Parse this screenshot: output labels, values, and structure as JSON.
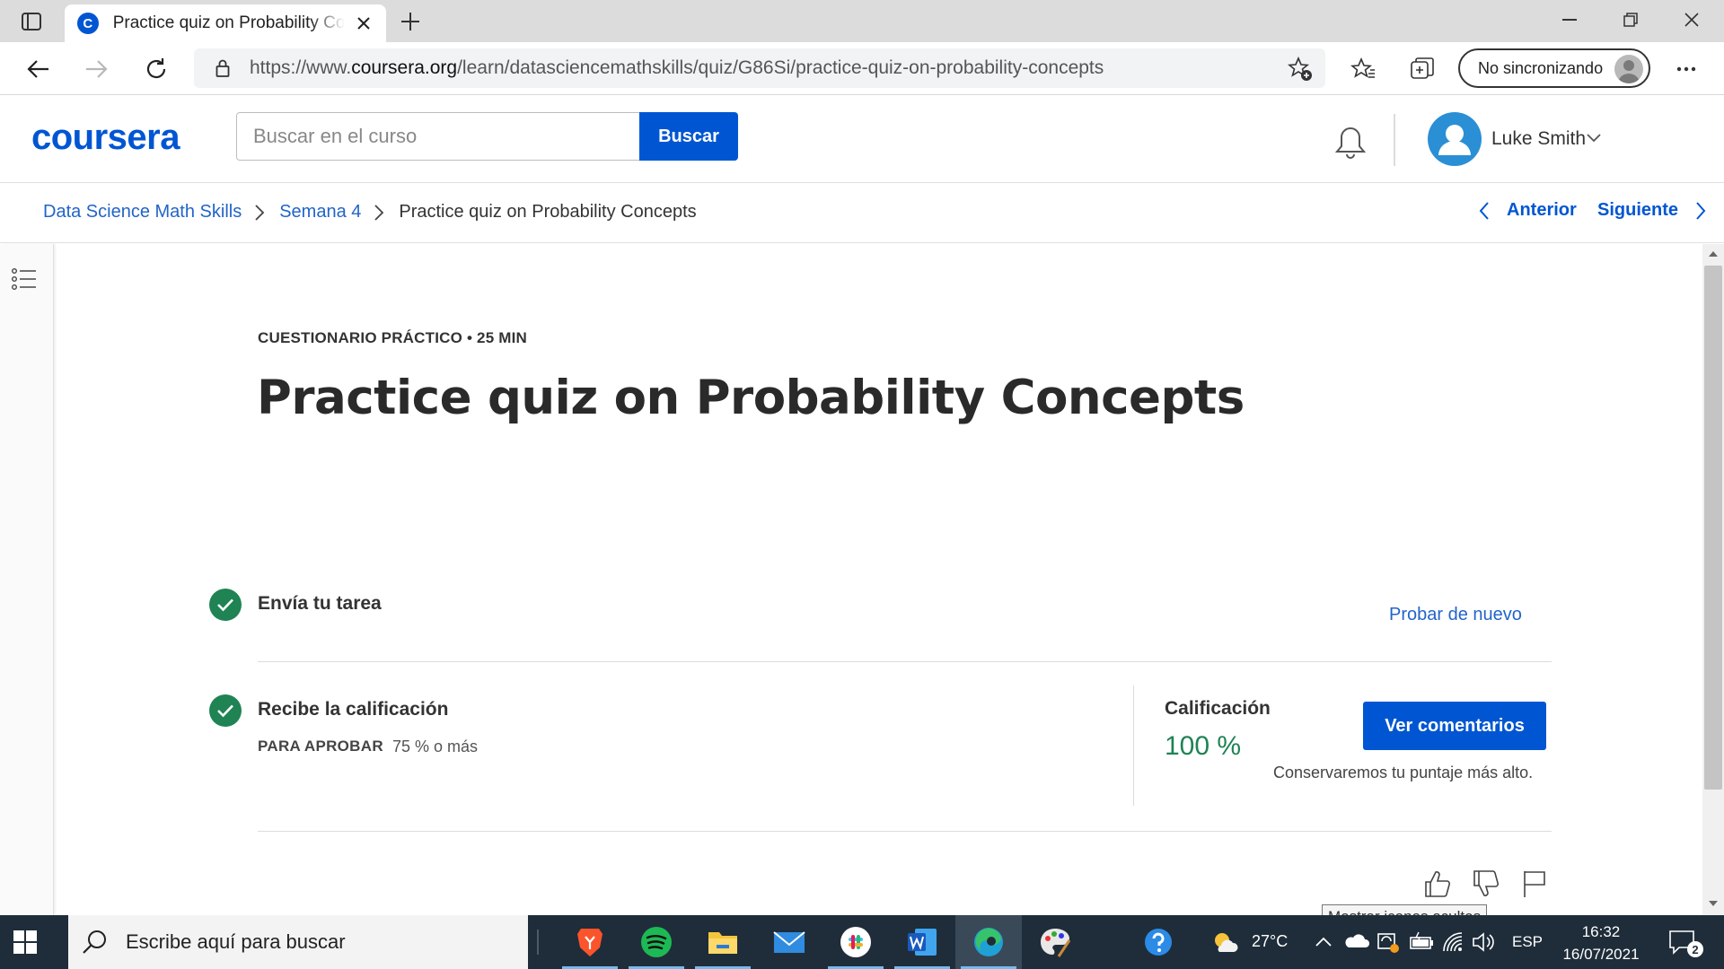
{
  "browser": {
    "tab_title": "Practice quiz on Probability Concepts",
    "tab_favicon_letter": "C",
    "url_prefix": "https://www.",
    "url_domain": "coursera.org",
    "url_path": "/learn/datasciencemathskills/quiz/G86Si/practice-quiz-on-probability-concepts",
    "sync_label": "No sincronizando"
  },
  "header": {
    "logo": "coursera",
    "search_placeholder": "Buscar en el curso",
    "search_button": "Buscar",
    "user_name": "Luke Smith"
  },
  "breadcrumb": {
    "items": [
      "Data Science Math Skills",
      "Semana 4",
      "Practice quiz on Probability Concepts"
    ],
    "prev_label": "Anterior",
    "next_label": "Siguiente"
  },
  "quiz": {
    "kicker": "CUESTIONARIO PRÁCTICO • 25 MIN",
    "title": "Practice quiz on Probability Concepts",
    "step1_title": "Envía tu tarea",
    "retry_label": "Probar de nuevo",
    "step2_title": "Recibe la calificación",
    "pass_label": "PARA APROBAR",
    "pass_value": "75 % o más",
    "grade_label": "Calificación",
    "grade_value": "100 %",
    "feedback_button": "Ver comentarios",
    "keep_note": "Conservaremos tu puntaje más alto."
  },
  "tooltip": "Mostrar iconos ocultos",
  "taskbar": {
    "search_placeholder": "Escribe aquí para buscar",
    "apps": [
      "brave-icon",
      "spotify-icon",
      "file-explorer-icon",
      "mail-icon",
      "slack-icon",
      "word-icon",
      "edge-icon",
      "paint-icon"
    ],
    "temperature": "27°C",
    "language": "ESP",
    "time": "16:32",
    "date": "16/07/2021",
    "notification_count": "2"
  },
  "colors": {
    "brand_blue": "#0056d2",
    "link_blue": "#2264c9",
    "success_green": "#1f8354",
    "taskbar": "#1f2d3a"
  }
}
